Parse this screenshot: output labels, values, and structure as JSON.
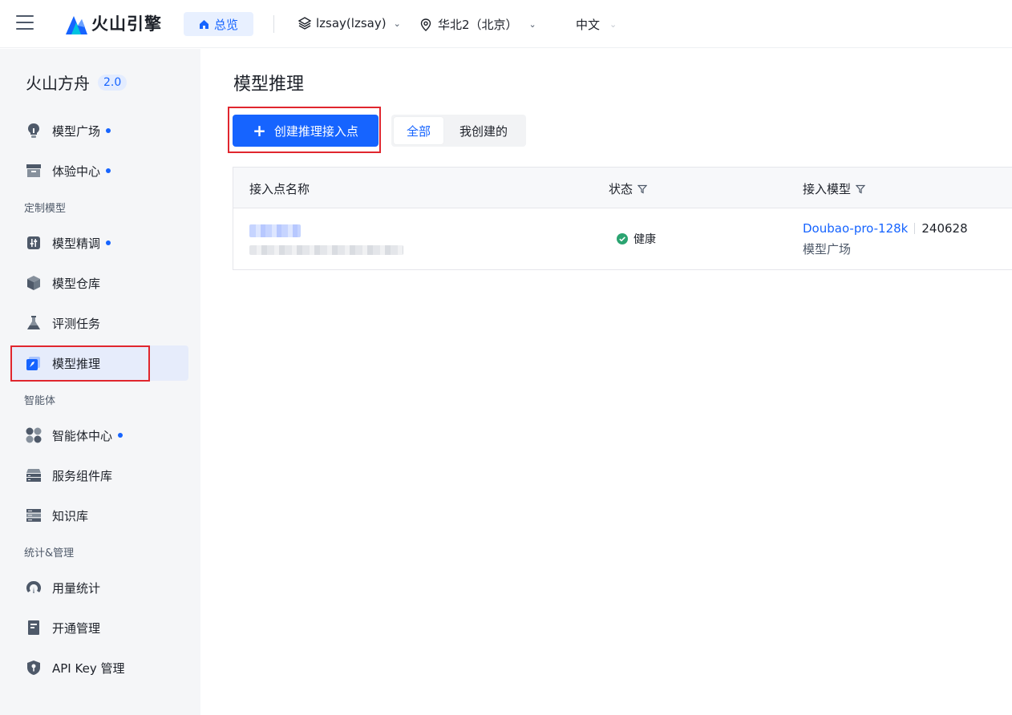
{
  "topbar": {
    "logo_text": "火山引擎",
    "home_label": "总览",
    "account_label": "lzsay(lzsay)",
    "region_label": "华北2（北京）",
    "lang_label": "中文"
  },
  "sidebar": {
    "brand_name": "火山方舟",
    "brand_version": "2.0",
    "items": [
      {
        "label": "模型广场",
        "icon": "bulb-icon",
        "dot": true
      },
      {
        "label": "体验中心",
        "icon": "box-icon",
        "dot": true
      },
      {
        "label": "模型精调",
        "icon": "tune-icon",
        "dot": true
      },
      {
        "label": "模型仓库",
        "icon": "cube-icon",
        "dot": false
      },
      {
        "label": "评测任务",
        "icon": "flask-icon",
        "dot": false
      },
      {
        "label": "模型推理",
        "icon": "rocket-icon",
        "dot": false,
        "active": true
      },
      {
        "label": "智能体中心",
        "icon": "grid-icon",
        "dot": true
      },
      {
        "label": "服务组件库",
        "icon": "stack-icon",
        "dot": false
      },
      {
        "label": "知识库",
        "icon": "server-icon",
        "dot": false
      },
      {
        "label": "用量统计",
        "icon": "gauge-icon",
        "dot": false
      },
      {
        "label": "开通管理",
        "icon": "doc-icon",
        "dot": false
      },
      {
        "label": "API Key 管理",
        "icon": "shield-key-icon",
        "dot": false
      }
    ],
    "sections": [
      "定制模型",
      "智能体",
      "统计&管理"
    ]
  },
  "main": {
    "title": "模型推理",
    "create_button": "创建推理接入点",
    "tabs": [
      "全部",
      "我创建的"
    ],
    "columns": [
      "接入点名称",
      "状态",
      "接入模型"
    ],
    "rows": [
      {
        "status": "健康",
        "model_name": "Doubao-pro-128k",
        "model_version": "240628",
        "model_source": "模型广场"
      }
    ]
  },
  "colors": {
    "accent": "#1664ff",
    "status_ok": "#2ba471",
    "highlight_box": "#e0262e"
  }
}
